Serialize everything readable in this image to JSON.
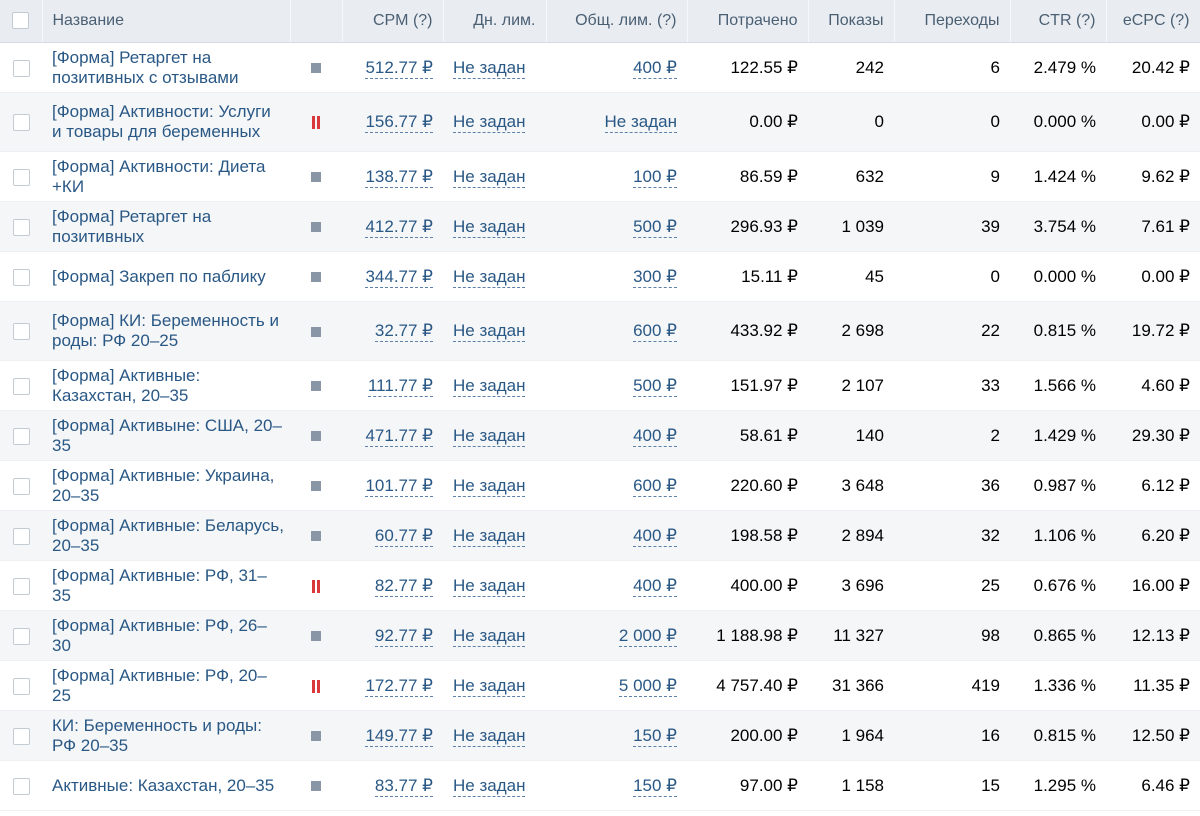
{
  "columns": {
    "name": "Название",
    "cpm": "CPM (?)",
    "day_limit": "Дн. лим.",
    "total_limit": "Общ. лим. (?)",
    "spent": "Потрачено",
    "views": "Показы",
    "clicks": "Переходы",
    "ctr": "CTR (?)",
    "ecpc": "eCPC (?)"
  },
  "status_colors": {
    "stopped": "#8896a6",
    "paused": "#d9393b"
  },
  "rows": [
    {
      "name": "[Форма] Ретаргет на позитивных с отзывами",
      "status": "stopped",
      "status_icon": "stopped-square-icon",
      "cpm": "512.77 ₽",
      "day_limit": "Не задан",
      "total_limit": "400 ₽",
      "spent": "122.55 ₽",
      "views": "242",
      "clicks": "6",
      "ctr": "2.479 %",
      "ecpc": "20.42 ₽"
    },
    {
      "name": "[Форма] Активности: Услуги и товары для беременных",
      "status": "paused",
      "status_icon": "pause-icon",
      "cpm": "156.77 ₽",
      "day_limit": "Не задан",
      "total_limit": "Не задан",
      "spent": "0.00 ₽",
      "views": "0",
      "clicks": "0",
      "ctr": "0.000 %",
      "ecpc": "0.00 ₽"
    },
    {
      "name": "[Форма] Активности: Диета +КИ",
      "status": "stopped",
      "status_icon": "stopped-square-icon",
      "cpm": "138.77 ₽",
      "day_limit": "Не задан",
      "total_limit": "100 ₽",
      "spent": "86.59 ₽",
      "views": "632",
      "clicks": "9",
      "ctr": "1.424 %",
      "ecpc": "9.62 ₽"
    },
    {
      "name": "[Форма] Ретаргет на позитивных",
      "status": "stopped",
      "status_icon": "stopped-square-icon",
      "cpm": "412.77 ₽",
      "day_limit": "Не задан",
      "total_limit": "500 ₽",
      "spent": "296.93 ₽",
      "views": "1 039",
      "clicks": "39",
      "ctr": "3.754 %",
      "ecpc": "7.61 ₽"
    },
    {
      "name": "[Форма] Закреп по паблику",
      "status": "stopped",
      "status_icon": "stopped-square-icon",
      "cpm": "344.77 ₽",
      "day_limit": "Не задан",
      "total_limit": "300 ₽",
      "spent": "15.11 ₽",
      "views": "45",
      "clicks": "0",
      "ctr": "0.000 %",
      "ecpc": "0.00 ₽"
    },
    {
      "name": "[Форма] КИ: Беременность и роды: РФ 20–25",
      "status": "stopped",
      "status_icon": "stopped-square-icon",
      "cpm": "32.77 ₽",
      "day_limit": "Не задан",
      "total_limit": "600 ₽",
      "spent": "433.92 ₽",
      "views": "2 698",
      "clicks": "22",
      "ctr": "0.815 %",
      "ecpc": "19.72 ₽"
    },
    {
      "name": "[Форма] Активные: Казахстан, 20–35",
      "status": "stopped",
      "status_icon": "stopped-square-icon",
      "cpm": "111.77 ₽",
      "day_limit": "Не задан",
      "total_limit": "500 ₽",
      "spent": "151.97 ₽",
      "views": "2 107",
      "clicks": "33",
      "ctr": "1.566 %",
      "ecpc": "4.60 ₽"
    },
    {
      "name": "[Форма] Активыне: США, 20–35",
      "status": "stopped",
      "status_icon": "stopped-square-icon",
      "cpm": "471.77 ₽",
      "day_limit": "Не задан",
      "total_limit": "400 ₽",
      "spent": "58.61 ₽",
      "views": "140",
      "clicks": "2",
      "ctr": "1.429 %",
      "ecpc": "29.30 ₽"
    },
    {
      "name": "[Форма] Активные: Украина, 20–35",
      "status": "stopped",
      "status_icon": "stopped-square-icon",
      "cpm": "101.77 ₽",
      "day_limit": "Не задан",
      "total_limit": "600 ₽",
      "spent": "220.60 ₽",
      "views": "3 648",
      "clicks": "36",
      "ctr": "0.987 %",
      "ecpc": "6.12 ₽"
    },
    {
      "name": "[Форма] Активные: Беларусь, 20–35",
      "status": "stopped",
      "status_icon": "stopped-square-icon",
      "cpm": "60.77 ₽",
      "day_limit": "Не задан",
      "total_limit": "400 ₽",
      "spent": "198.58 ₽",
      "views": "2 894",
      "clicks": "32",
      "ctr": "1.106 %",
      "ecpc": "6.20 ₽"
    },
    {
      "name": "[Форма] Активные: РФ, 31–35",
      "status": "paused",
      "status_icon": "pause-icon",
      "cpm": "82.77 ₽",
      "day_limit": "Не задан",
      "total_limit": "400 ₽",
      "spent": "400.00 ₽",
      "views": "3 696",
      "clicks": "25",
      "ctr": "0.676 %",
      "ecpc": "16.00 ₽"
    },
    {
      "name": "[Форма] Активные: РФ, 26–30",
      "status": "stopped",
      "status_icon": "stopped-square-icon",
      "cpm": "92.77 ₽",
      "day_limit": "Не задан",
      "total_limit": "2 000 ₽",
      "spent": "1 188.98 ₽",
      "views": "11 327",
      "clicks": "98",
      "ctr": "0.865 %",
      "ecpc": "12.13 ₽"
    },
    {
      "name": "[Форма] Активные: РФ, 20–25",
      "status": "paused",
      "status_icon": "pause-icon",
      "cpm": "172.77 ₽",
      "day_limit": "Не задан",
      "total_limit": "5 000 ₽",
      "spent": "4 757.40 ₽",
      "views": "31 366",
      "clicks": "419",
      "ctr": "1.336 %",
      "ecpc": "11.35 ₽"
    },
    {
      "name": "КИ: Беременность и роды: РФ 20–35",
      "status": "stopped",
      "status_icon": "stopped-square-icon",
      "cpm": "149.77 ₽",
      "day_limit": "Не задан",
      "total_limit": "150 ₽",
      "spent": "200.00 ₽",
      "views": "1 964",
      "clicks": "16",
      "ctr": "0.815 %",
      "ecpc": "12.50 ₽"
    },
    {
      "name": "Активные: Казахстан, 20–35",
      "status": "stopped",
      "status_icon": "stopped-square-icon",
      "cpm": "83.77 ₽",
      "day_limit": "Не задан",
      "total_limit": "150 ₽",
      "spent": "97.00 ₽",
      "views": "1 158",
      "clicks": "15",
      "ctr": "1.295 %",
      "ecpc": "6.46 ₽"
    }
  ]
}
